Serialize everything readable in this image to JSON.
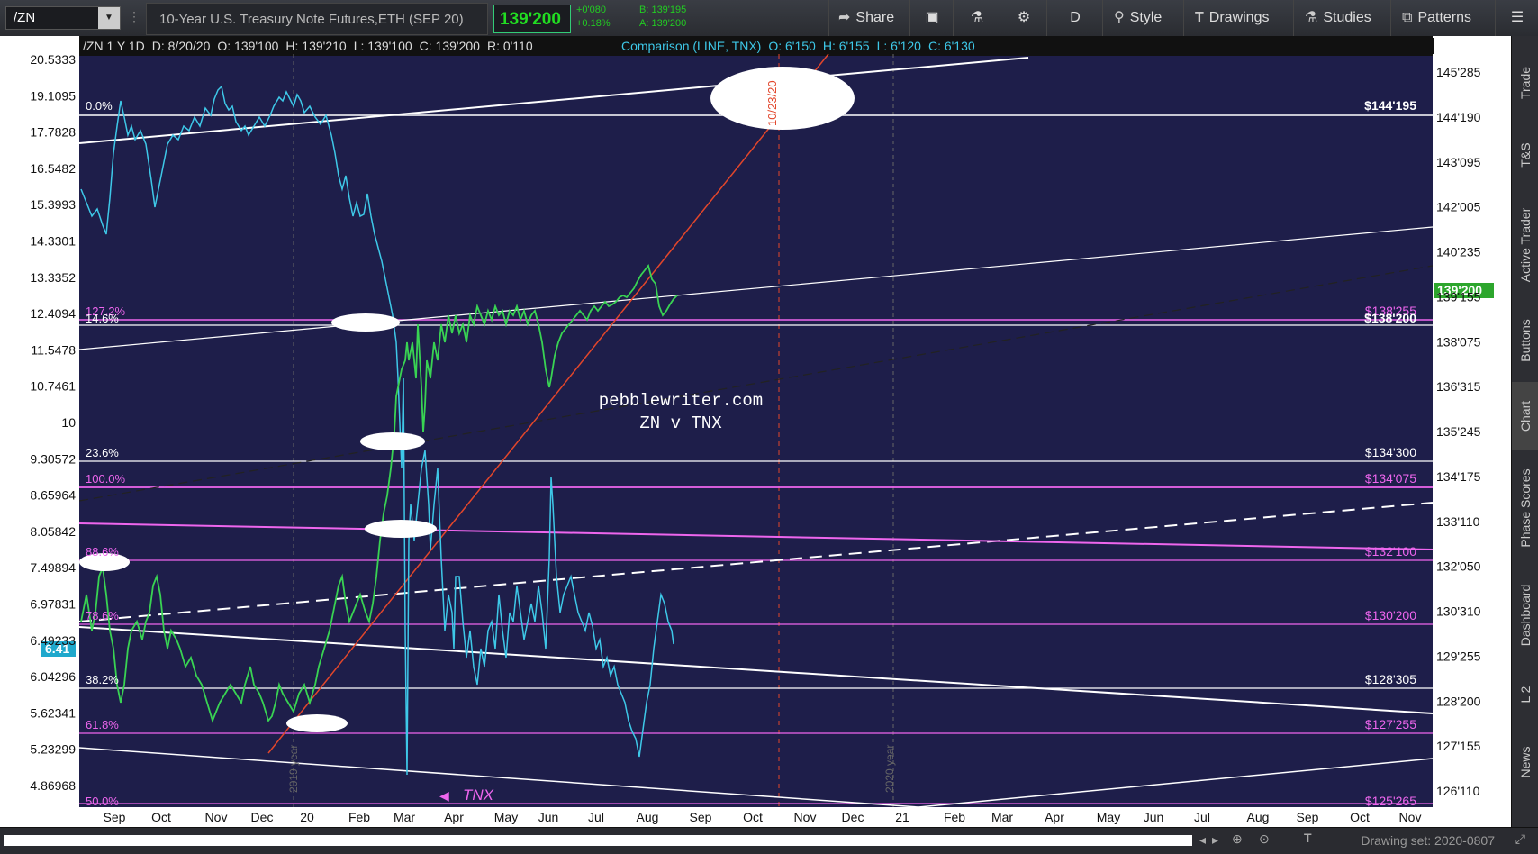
{
  "toolbar": {
    "symbol": "/ZN",
    "description": "10-Year U.S. Treasury Note Futures,ETH (SEP 20)",
    "last_price": "139'200",
    "change_abs": "+0'080",
    "change_pct": "+0.18%",
    "bid": "B: 139'195",
    "ask": "A: 139'200",
    "buttons": [
      "Share",
      "D",
      "Style",
      "Drawings",
      "Studies",
      "Patterns"
    ]
  },
  "chart_header": {
    "main": [
      "/ZN 1 Y 1D",
      "D: 8/20/20",
      "O: 139'100",
      "H: 139'210",
      "L: 139'100",
      "C: 139'200",
      "R: 0'110"
    ],
    "comparison": [
      "Comparison (LINE, TNX)",
      "O: 6'150",
      "H: 6'155",
      "L: 6'120",
      "C: 6'130"
    ]
  },
  "chart_data": {
    "type": "line",
    "annotations": [
      "pebblewriter.com",
      "ZN v TNX"
    ],
    "left_axis_ticks": [
      "20.5333",
      "19.1095",
      "17.7828",
      "16.5482",
      "15.3993",
      "14.3301",
      "13.3352",
      "12.4094",
      "11.5478",
      "10.7461",
      "10",
      "9.30572",
      "8.65964",
      "8.05842",
      "7.49894",
      "6.97831",
      "6.49233",
      "6.04296",
      "5.62341",
      "5.23299",
      "4.86968"
    ],
    "right_axis_ticks": [
      "145'285",
      "144'190",
      "143'095",
      "142'005",
      "140'235",
      "139'155",
      "138'075",
      "136'315",
      "135'245",
      "134'175",
      "133'110",
      "132'050",
      "130'310",
      "129'255",
      "128'200",
      "127'155",
      "126'110"
    ],
    "x_axis_ticks": [
      "Sep",
      "Oct",
      "Nov",
      "Dec",
      "20",
      "Feb",
      "Mar",
      "Apr",
      "May",
      "Jun",
      "Jul",
      "Aug",
      "Sep",
      "Oct",
      "Nov",
      "Dec",
      "21",
      "Feb",
      "Mar",
      "Apr",
      "May",
      "Jun",
      "Jul",
      "Aug",
      "Sep",
      "Oct",
      "Nov"
    ],
    "fib_levels": [
      {
        "pct": "0.0%",
        "price": "$144'195",
        "color": "#ffffff"
      },
      {
        "pct": "127.2%",
        "price": "$138'255",
        "color": "#ee66ee"
      },
      {
        "pct": "14.6%",
        "price": "$138'200",
        "color": "#ffffff"
      },
      {
        "pct": "23.6%",
        "price": "$134'300",
        "color": "#ffffff"
      },
      {
        "pct": "100.0%",
        "price": "$134'075",
        "color": "#ee66ee"
      },
      {
        "pct": "88.6%",
        "price": "$132'100",
        "color": "#ee66ee"
      },
      {
        "pct": "78.6%",
        "price": "$130'200",
        "color": "#ee66ee"
      },
      {
        "pct": "38.2%",
        "price": "$128'305",
        "color": "#ffffff"
      },
      {
        "pct": "61.8%",
        "price": "$127'255",
        "color": "#ee66ee"
      },
      {
        "pct": "50.0%",
        "price": "$125'265",
        "color": "#ee66ee"
      }
    ],
    "tags": {
      "zn_last": "139'200",
      "tnx_last": "6.41"
    },
    "vertical_markers": [
      "10/23/20",
      "2019 year",
      "2020 year"
    ],
    "comparison_label": "TNX",
    "series": [
      {
        "name": "TNX",
        "color": "#3ec8e8"
      },
      {
        "name": "/ZN",
        "color": "#39d353"
      }
    ]
  },
  "right_tabs": [
    "Trade",
    "T&S",
    "Active Trader",
    "Buttons",
    "Chart",
    "Phase Scores",
    "Dashboard",
    "L 2",
    "News"
  ],
  "bottom": {
    "drawing_set": "Drawing set: 2020-0807"
  },
  "colors": {
    "chart_bg": "#1e1e4a",
    "tnx": "#3ec8e8",
    "up_candle": "#39d353",
    "down_candle": "#e2462b",
    "fib_white": "#ffffff",
    "fib_magenta": "#ee66ee"
  }
}
